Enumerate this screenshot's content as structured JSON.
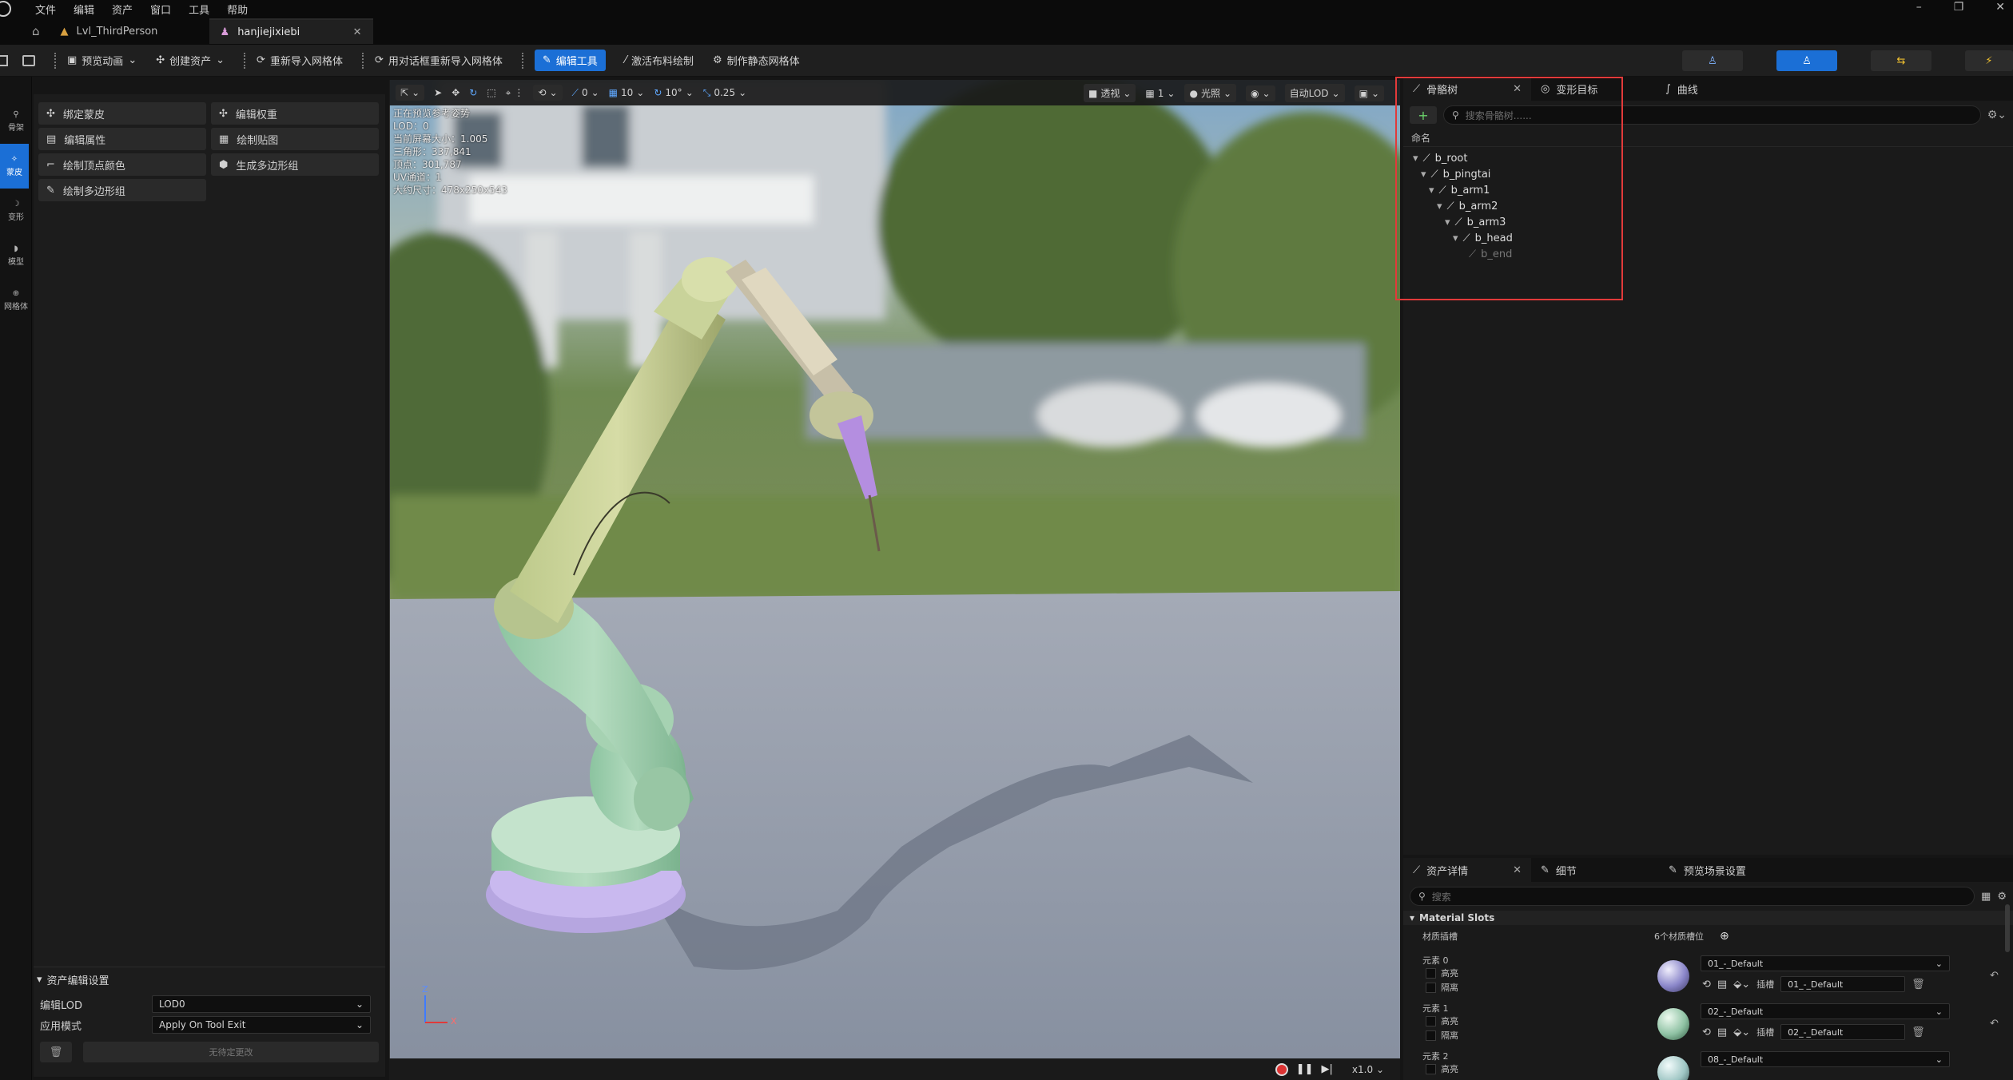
{
  "menu": [
    "文件",
    "编辑",
    "资产",
    "窗口",
    "工具",
    "帮助"
  ],
  "tabs": [
    {
      "label": "Lvl_ThirdPerson"
    },
    {
      "label": "hanjiejixiebi"
    }
  ],
  "toolbar": {
    "preview_anim": "预览动画",
    "create_asset": "创建资产",
    "reimport": "重新导入网格体",
    "reimport_dialog": "用对话框重新导入网格体",
    "edit_tools": "编辑工具",
    "cloth_paint": "激活布料绘制",
    "make_static": "制作静态网格体"
  },
  "modes": [
    {
      "label": "骨架"
    },
    {
      "label": "蒙皮"
    },
    {
      "label": "变形"
    },
    {
      "label": "模型"
    },
    {
      "label": "网格体"
    }
  ],
  "tools": [
    {
      "label": "绑定蒙皮"
    },
    {
      "label": "编辑权重"
    },
    {
      "label": "编辑属性"
    },
    {
      "label": "绘制贴图"
    },
    {
      "label": "绘制顶点颜色"
    },
    {
      "label": "生成多边形组"
    },
    {
      "label": "绘制多边形组"
    }
  ],
  "asset_settings": {
    "title": "资产编辑设置",
    "lod_label": "编辑LOD",
    "lod_value": "LOD0",
    "mode_label": "应用模式",
    "mode_value": "Apply On Tool Exit",
    "no_changes": "无待定更改"
  },
  "viewport": {
    "toolbar": {
      "rot": "0",
      "snap_move": "10",
      "snap_rot": "10°",
      "snap_scale": "0.25",
      "perspective": "透视",
      "split": "1",
      "lighting": "光照",
      "auto_lod": "自动LOD"
    },
    "stats": [
      "正在预览参考姿势",
      "LOD：0",
      "当前屏幕大小：1.005",
      "三角形：337,841",
      "顶点：301,787",
      "UV通道：1",
      "大约尺寸：478x250x543"
    ],
    "axis_z": "Z",
    "axis_x": "X",
    "speed": "x1.0"
  },
  "skeleton_panel": {
    "tab_skeleton": "骨骼树",
    "tab_morph": "变形目标",
    "tab_curve": "曲线",
    "search_placeholder": "搜索骨骼树......",
    "column": "命名",
    "bones": [
      {
        "name": "b_root",
        "depth": 0
      },
      {
        "name": "b_pingtai",
        "depth": 1
      },
      {
        "name": "b_arm1",
        "depth": 2
      },
      {
        "name": "b_arm2",
        "depth": 3
      },
      {
        "name": "b_arm3",
        "depth": 4
      },
      {
        "name": "b_head",
        "depth": 5
      },
      {
        "name": "b_end",
        "depth": 6
      }
    ]
  },
  "details_panel": {
    "tab_asset": "资产详情",
    "tab_details": "细节",
    "tab_preview": "预览场景设置",
    "search_placeholder": "搜索",
    "section": "Material Slots",
    "slots_label": "材质插槽",
    "slots_count": "6个材质槽位",
    "highlight": "高亮",
    "isolate": "隔离",
    "slot_label": "插槽",
    "elements": [
      {
        "name": "元素 0",
        "material": "01_-_Default",
        "slot": "01_-_Default",
        "color": "#8a86c9"
      },
      {
        "name": "元素 1",
        "material": "02_-_Default",
        "slot": "02_-_Default",
        "color": "#8fc2a4"
      },
      {
        "name": "元素 2",
        "material": "08_-_Default",
        "slot": "",
        "color": "#9fc6c4"
      }
    ]
  },
  "colors": {
    "accent": "#1b6fd6",
    "highlight_box": "#e23a3a"
  }
}
